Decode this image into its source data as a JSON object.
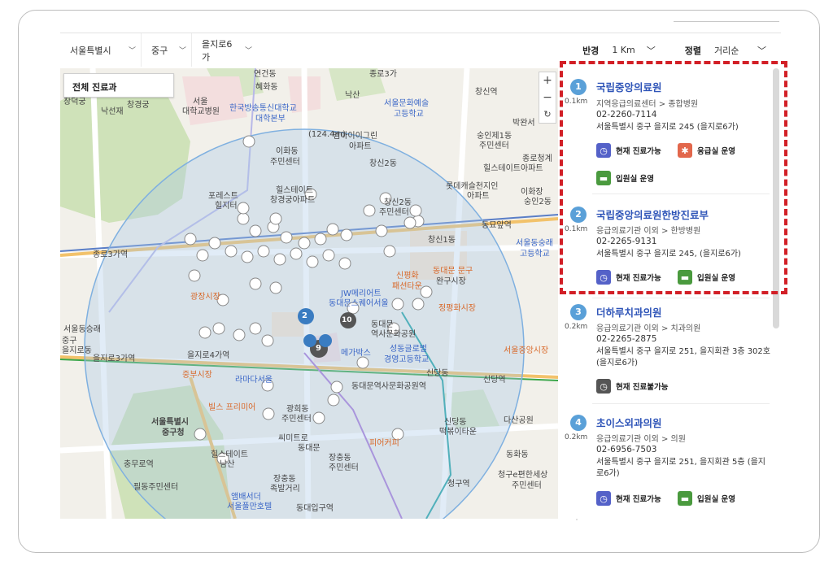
{
  "filters": {
    "city": "서울특별시",
    "district": "중구",
    "dong": "을지로6가",
    "radius_label": "반경",
    "radius_value": "1 Km",
    "sort_label": "정렬",
    "sort_value": "거리순"
  },
  "map": {
    "department_filter": "전체 진료과",
    "zoom_in": "+",
    "zoom_out": "−",
    "reset": "↻",
    "markers": {
      "highlight_1": "2",
      "highlight_2": "9",
      "highlight_3": "10"
    },
    "labels": [
      "이화동",
      "혜화동",
      "연건동",
      "한국방송통신대학교",
      "대학본부",
      "서울",
      "대학교병원",
      "창경궁",
      "낙선재",
      "창덕궁",
      "서울문화예술",
      "고등학교",
      "창신역",
      "박완서",
      "엠아이이그린",
      "아파트",
      "이화동",
      "주민센터",
      "창신2동",
      "숭인제1동",
      "주민센터",
      "종로청계",
      "힐스테이트아파트",
      "롯데캐슬천지인",
      "아파트",
      "힐스테이트",
      "창경궁아파트",
      "포레스트",
      "힐지터",
      "창신2동",
      "주민센터",
      "동묘앞역",
      "종로3가역",
      "창신1동",
      "서울동숭래",
      "고등학교",
      "신평화",
      "패션타운",
      "동대문 문구",
      "완구시장",
      "JW메리어트",
      "동대문스퀘어서울",
      "정평화시장",
      "광장시장",
      "동대문",
      "역사문화공원",
      "을지로4가역",
      "을지로3가역",
      "중부시장",
      "메가박스",
      "성동글로벌",
      "경영고등학교",
      "신당동",
      "서울중앙시장",
      "신당역",
      "동대문역사문화공원역",
      "라마다서울",
      "빌스 프리미어",
      "광희동",
      "주민센터",
      "서울특별시",
      "중구청",
      "힐스테이트",
      "남산",
      "충무로역",
      "필동주민센터",
      "장충동",
      "족발거리",
      "동대입구역",
      "앰배서더",
      "서울풀만호텔",
      "신당동",
      "떡볶이타운",
      "다산공원",
      "청구역",
      "동화동",
      "청구e편한세상",
      "주민센터",
      "씨미트로",
      "동대문",
      "장충동",
      "주민센터",
      "피어커피",
      "동대문역사문화공원",
      "종로3가",
      "낙산",
      "(124.4m)",
      "이화장",
      "숭인2동",
      "주민센터",
      "서울동승래",
      "중구",
      "을지로동",
      "주민센터"
    ]
  },
  "list": [
    {
      "num": "1",
      "dist": "0.1km",
      "title": "국립중앙의료원",
      "category": "지역응급의료센터 > 종합병원",
      "phone": "02-2260-7114",
      "address": "서울특별시 중구 을지로 245 (을지로6가)",
      "badges": [
        "현재 진료가능",
        "응급실 운영",
        "입원실 운영"
      ]
    },
    {
      "num": "2",
      "dist": "0.1km",
      "title": "국립중앙의료원한방진료부",
      "category": "응급의료기관 이외 > 한방병원",
      "phone": "02-2265-9131",
      "address": "서울특별시 중구 을지로 245, (을지로6가)",
      "badges": [
        "현재 진료가능",
        "입원실 운영"
      ]
    },
    {
      "num": "3",
      "dist": "0.2km",
      "title": "더하루치과의원",
      "category": "응급의료기관 이외 > 치과의원",
      "phone": "02-2265-2875",
      "address": "서울특별시 중구 을지로 251, 을지회관 3층 302호 (을지로6가)",
      "badges": [
        "현재 진료불가능"
      ]
    },
    {
      "num": "4",
      "dist": "0.2km",
      "title": "초이스외과의원",
      "category": "응급의료기관 이외 > 의원",
      "phone": "02-6956-7503",
      "address": "서울특별시 중구 을지로 251, 을지회관 5층 (을지로6가)",
      "badges": [
        "현재 진료가능",
        "입원실 운영"
      ]
    }
  ],
  "colors": {
    "accent": "#2f55b8",
    "highlight_border": "#d21f26",
    "number_badge": "#5aa0d8"
  }
}
